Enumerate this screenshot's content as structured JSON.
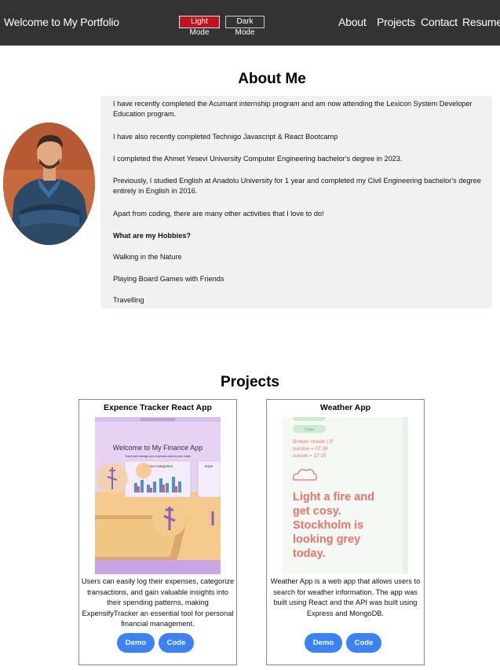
{
  "header": {
    "brand": "Welcome to My Portfolio",
    "light_mode": "Light Mode",
    "dark_mode": "Dark Mode",
    "nav": [
      "About",
      "Projects",
      "Contact",
      "Resume"
    ]
  },
  "about": {
    "title": "About Me",
    "paragraphs": [
      "I have recently completed the Acumant internship program and am now attending the Lexicon System Developer Education program.",
      "I have also recently completed Technigo Javascript & React Bootcamp",
      "I completed the Ahmet Yesevi University Computer Engineering bachelor's degree in 2023.",
      "Previously, I studied English at Anadolu University for 1 year and completed my Civil Engineering bachelor's degree entirely in English in 2016.",
      "Apart from coding, there are many other activities that I love to do!",
      "What are my Hobbies?",
      "Walking in the Nature",
      "Playing Board Games with Friends",
      "Travelling"
    ]
  },
  "projects": {
    "title": "Projects",
    "items": [
      {
        "title": "Expence Tracker React App",
        "image_heading": "Welcome to My Finance App",
        "image_sub": "Track and manage your expenses and income easily",
        "image_panel": "Income Categories",
        "image_panel_right": "Expe",
        "description": "Users can easily log their expenses, categorize transactions, and gain valuable insights into their spending patterns, making ExpensifyTracker an essential tool for personal financial management.",
        "demo": "Demo",
        "code": "Code"
      },
      {
        "title": "Weather App",
        "image_pill_1": "Clear",
        "image_weather": "Broken clouds | 5°",
        "image_sunrise": "sunrise = 07:38",
        "image_sunset": "sunset = 17:25",
        "image_message": "Light a fire and get cosy. Stockholm is looking grey today.",
        "description": "Weather App is a web app that allows users to search for weather information. The app was built using React and the API was built using Express and MongoDB.",
        "demo": "Demo",
        "code": "Code"
      }
    ]
  },
  "colors": {
    "header_bg": "#333333",
    "light_mode_bg": "#c8101d",
    "button_blue": "#3b82f6",
    "card_bg": "#f1f1f1",
    "weather_accent": "#f0706a"
  }
}
